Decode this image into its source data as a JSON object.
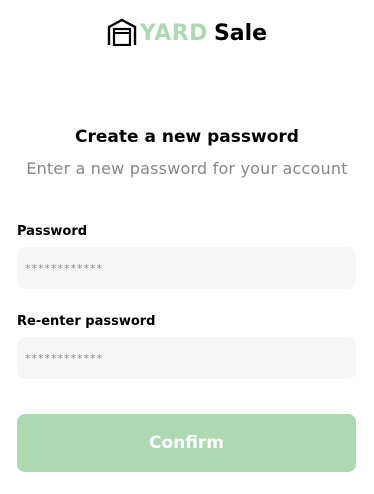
{
  "brand": {
    "logo_icon": "garage-icon",
    "name_part1": "YARD",
    "name_part2": "Sale",
    "accent_color": "#ACD9B2"
  },
  "header": {
    "title": "Create a new password",
    "subtitle": "Enter a new password for your account"
  },
  "form": {
    "password": {
      "label": "Password",
      "placeholder": "************"
    },
    "confirm_password": {
      "label": "Re-enter password",
      "placeholder": "************"
    },
    "submit_label": "Confirm"
  }
}
